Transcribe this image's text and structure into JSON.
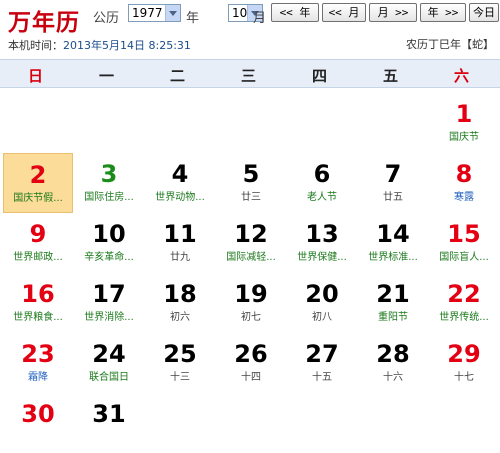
{
  "header": {
    "logo": "万年历",
    "calendar_type": "公历",
    "year_value": "1977",
    "year_label": "年",
    "month_value": "10",
    "month_label": "月",
    "buttons": [
      "<< 年",
      "<< 月",
      "月 >>",
      "年 >>",
      "今日"
    ],
    "local_time_label": "本机时间：",
    "local_time_value": "2013年5月14日 8:25:31",
    "lunar_info": "农历丁巳年【蛇】"
  },
  "weekdays": [
    "日",
    "一",
    "二",
    "三",
    "四",
    "五",
    "六"
  ],
  "days": [
    {
      "day": "1",
      "sub": "国庆节",
      "col": 6,
      "row": 0
    },
    {
      "day": "2",
      "sub": "国庆节假...",
      "col": 0,
      "row": 1,
      "today": true
    },
    {
      "day": "3",
      "sub": "国际住房...",
      "col": 1,
      "row": 1
    },
    {
      "day": "4",
      "sub": "世界动物...",
      "col": 2,
      "row": 1
    },
    {
      "day": "5",
      "sub": "廿三",
      "col": 3,
      "row": 1
    },
    {
      "day": "6",
      "sub": "老人节",
      "col": 4,
      "row": 1
    },
    {
      "day": "7",
      "sub": "廿五",
      "col": 5,
      "row": 1
    },
    {
      "day": "8",
      "sub": "寒露",
      "col": 6,
      "row": 1
    },
    {
      "day": "9",
      "sub": "世界邮政...",
      "col": 0,
      "row": 2
    },
    {
      "day": "10",
      "sub": "辛亥革命...",
      "col": 1,
      "row": 2
    },
    {
      "day": "11",
      "sub": "廿九",
      "col": 2,
      "row": 2
    },
    {
      "day": "12",
      "sub": "国际减轻...",
      "col": 3,
      "row": 2
    },
    {
      "day": "13",
      "sub": "世界保健...",
      "col": 4,
      "row": 2
    },
    {
      "day": "14",
      "sub": "世界标准...",
      "col": 5,
      "row": 2
    },
    {
      "day": "15",
      "sub": "国际盲人...",
      "col": 6,
      "row": 2
    },
    {
      "day": "16",
      "sub": "世界粮食...",
      "col": 0,
      "row": 3
    },
    {
      "day": "17",
      "sub": "世界消除...",
      "col": 1,
      "row": 3
    },
    {
      "day": "18",
      "sub": "初六",
      "col": 2,
      "row": 3
    },
    {
      "day": "19",
      "sub": "初七",
      "col": 3,
      "row": 3
    },
    {
      "day": "20",
      "sub": "初八",
      "col": 4,
      "row": 3
    },
    {
      "day": "21",
      "sub": "重阳节",
      "col": 5,
      "row": 3
    },
    {
      "day": "22",
      "sub": "世界传统...",
      "col": 6,
      "row": 3
    },
    {
      "day": "23",
      "sub": "霜降",
      "col": 0,
      "row": 4
    },
    {
      "day": "24",
      "sub": "联合国日",
      "col": 1,
      "row": 4
    },
    {
      "day": "25",
      "sub": "十三",
      "col": 2,
      "row": 4
    },
    {
      "day": "26",
      "sub": "十四",
      "col": 3,
      "row": 4
    },
    {
      "day": "27",
      "sub": "十五",
      "col": 4,
      "row": 4
    },
    {
      "day": "28",
      "sub": "十六",
      "col": 5,
      "row": 4
    },
    {
      "day": "29",
      "sub": "十七",
      "col": 6,
      "row": 4
    },
    {
      "day": "30",
      "sub": "",
      "col": 0,
      "row": 5
    },
    {
      "day": "31",
      "sub": "",
      "col": 1,
      "row": 5
    }
  ],
  "colors": {
    "weekend": "#e30012",
    "festival": "#1c7a1c",
    "solar_term": "#2060c0",
    "today_bg": "#fbdc98"
  }
}
